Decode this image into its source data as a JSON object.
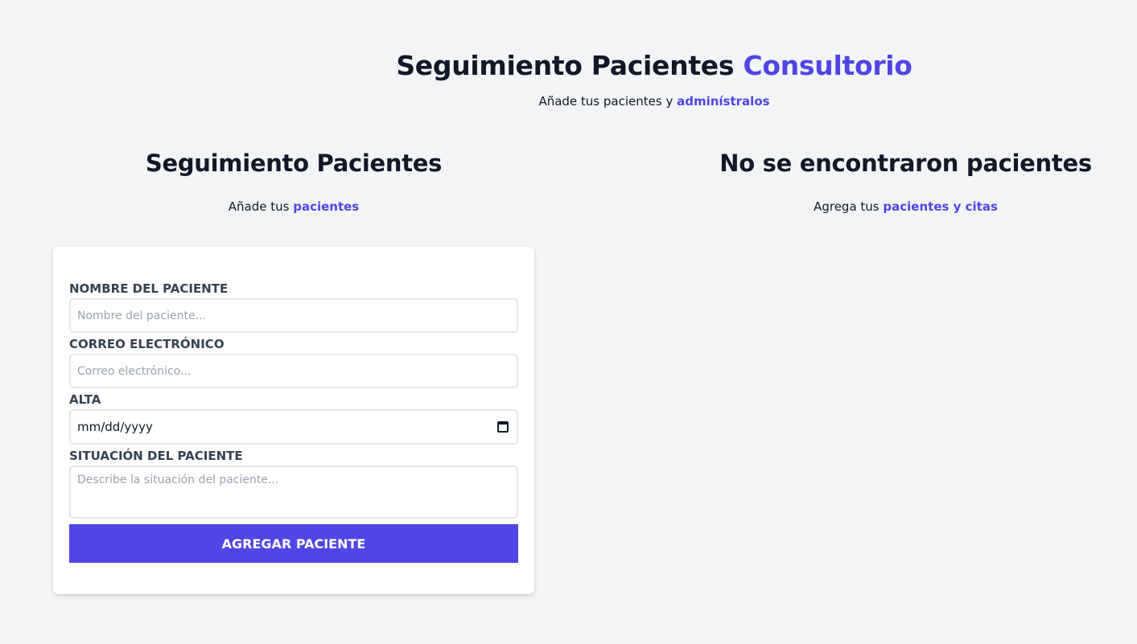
{
  "header": {
    "title_main": "Seguimiento Pacientes",
    "title_accent": "Consultorio",
    "subtitle_prefix": "Añade tus pacientes y",
    "subtitle_accent": "adminístralos"
  },
  "form_section": {
    "title": "Seguimiento Pacientes",
    "subtitle_prefix": "Añade tus",
    "subtitle_accent": "pacientes"
  },
  "list_section": {
    "title": "No se encontraron pacientes",
    "subtitle_prefix": "Agrega tus",
    "subtitle_accent": "pacientes y citas"
  },
  "form": {
    "name": {
      "label": "NOMBRE DEL PACIENTE",
      "placeholder": "Nombre del paciente...",
      "value": ""
    },
    "email": {
      "label": "CORREO ELECTRÓNICO",
      "placeholder": "Correo electrónico...",
      "value": ""
    },
    "discharge": {
      "label": "ALTA",
      "value": "mm/dd/yyyy",
      "icon": "calendar-icon"
    },
    "situation": {
      "label": "SITUACIÓN DEL PACIENTE",
      "placeholder": "Describe la situación del paciente...",
      "value": ""
    },
    "submit_label": "AGREGAR PACIENTE"
  },
  "colors": {
    "accent": "#4f46e5",
    "background": "#f3f4f6",
    "card": "#ffffff"
  }
}
